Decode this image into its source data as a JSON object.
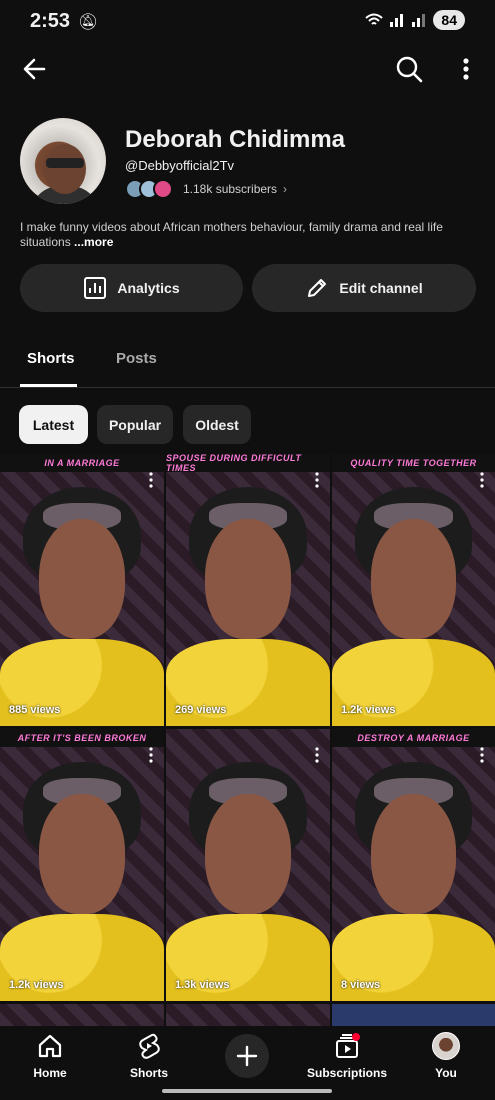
{
  "status_bar": {
    "time": "2:53",
    "battery": "84"
  },
  "channel": {
    "name": "Deborah Chidimma",
    "handle": "@Debbyofficial2Tv",
    "subscribers": "1.18k subscribers",
    "description": "I make funny videos about African mothers behaviour,  family drama and real life situations ",
    "more_label": "...more"
  },
  "actions": {
    "analytics": "Analytics",
    "edit_channel": "Edit channel"
  },
  "tabs": [
    {
      "label": "Shorts"
    },
    {
      "label": "Posts"
    }
  ],
  "filters": [
    {
      "label": "Latest"
    },
    {
      "label": "Popular"
    },
    {
      "label": "Oldest"
    }
  ],
  "shorts": [
    {
      "caption": "In a marriage",
      "views": "885 views"
    },
    {
      "caption": "spouse during difficult times",
      "views": "269 views"
    },
    {
      "caption": "quality time together",
      "views": "1.2k views"
    },
    {
      "caption": "After it's been broken",
      "views": "1.2k views"
    },
    {
      "caption": "",
      "views": "1.3k views"
    },
    {
      "caption": "Destroy a marriage",
      "views": "8 views"
    }
  ],
  "bottom_nav": {
    "home": "Home",
    "shorts": "Shorts",
    "subscriptions": "Subscriptions",
    "you": "You"
  },
  "colors": {
    "background": "#0f0f0f",
    "chip_active": "#f1f1f1",
    "button": "#272727",
    "caption": "#ff7ad9"
  }
}
